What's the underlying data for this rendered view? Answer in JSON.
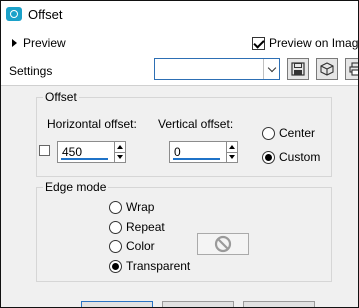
{
  "window": {
    "title": "Offset",
    "app_icon": "offset-app-icon"
  },
  "toolbar": {
    "preview_toggle_label": "Preview",
    "preview_on_image_label": "Preview on Image",
    "preview_on_image_checked": true,
    "settings_label": "Settings",
    "settings_value": "",
    "save_icon": "floppy-disk-icon",
    "presets_icon": "cube-icon",
    "print_icon": "printer-icon"
  },
  "offset_group": {
    "legend": "Offset",
    "horizontal_label": "Horizontal offset:",
    "horizontal_value": "450",
    "vertical_label": "Vertical offset:",
    "vertical_value": "0",
    "link_checked": false,
    "origin_options": [
      {
        "label": "Center",
        "selected": false
      },
      {
        "label": "Custom",
        "selected": true
      }
    ]
  },
  "edge_group": {
    "legend": "Edge mode",
    "options": [
      {
        "label": "Wrap",
        "selected": false
      },
      {
        "label": "Repeat",
        "selected": false
      },
      {
        "label": "Color",
        "selected": false
      },
      {
        "label": "Transparent",
        "selected": true
      }
    ],
    "color_swatch_icon": "no-color-icon"
  },
  "colors": {
    "accent": "#1f73c8",
    "app_icon": "#1ba1c9",
    "dialog_bg": "#f0f0f0"
  }
}
